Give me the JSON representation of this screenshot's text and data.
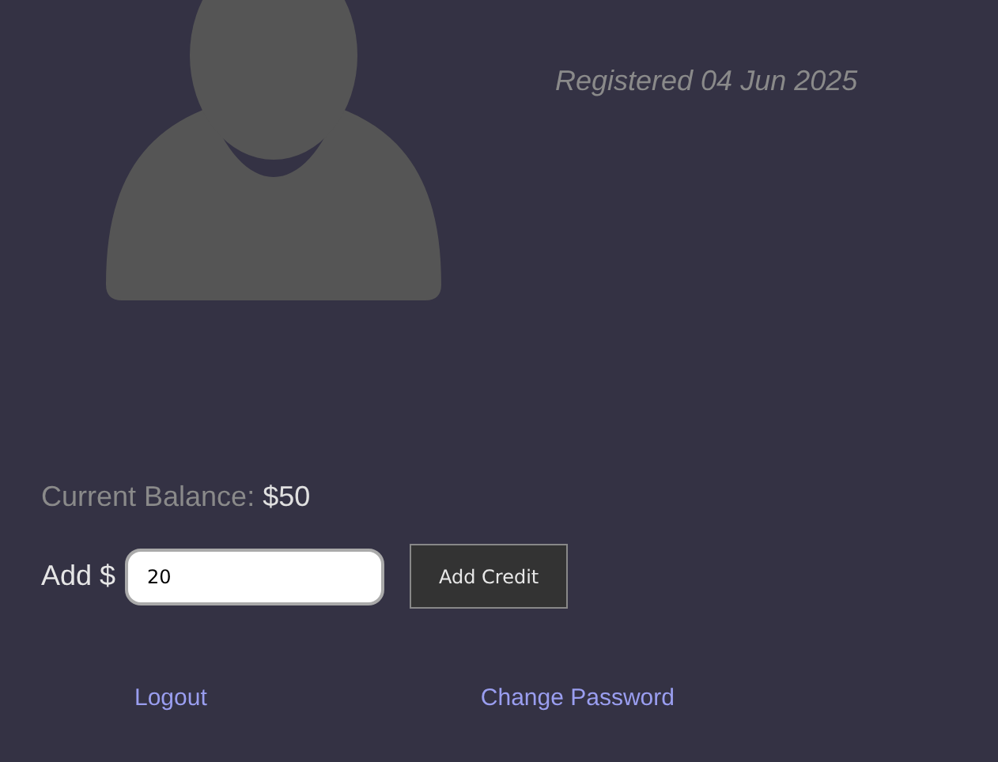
{
  "profile": {
    "registered": "Registered 04 Jun 2025"
  },
  "balance": {
    "label": "Current Balance:",
    "amount": "$50"
  },
  "add_credit": {
    "label": "Add $",
    "value": "20",
    "button": "Add Credit"
  },
  "links": [
    "Logout",
    "Change Password"
  ]
}
